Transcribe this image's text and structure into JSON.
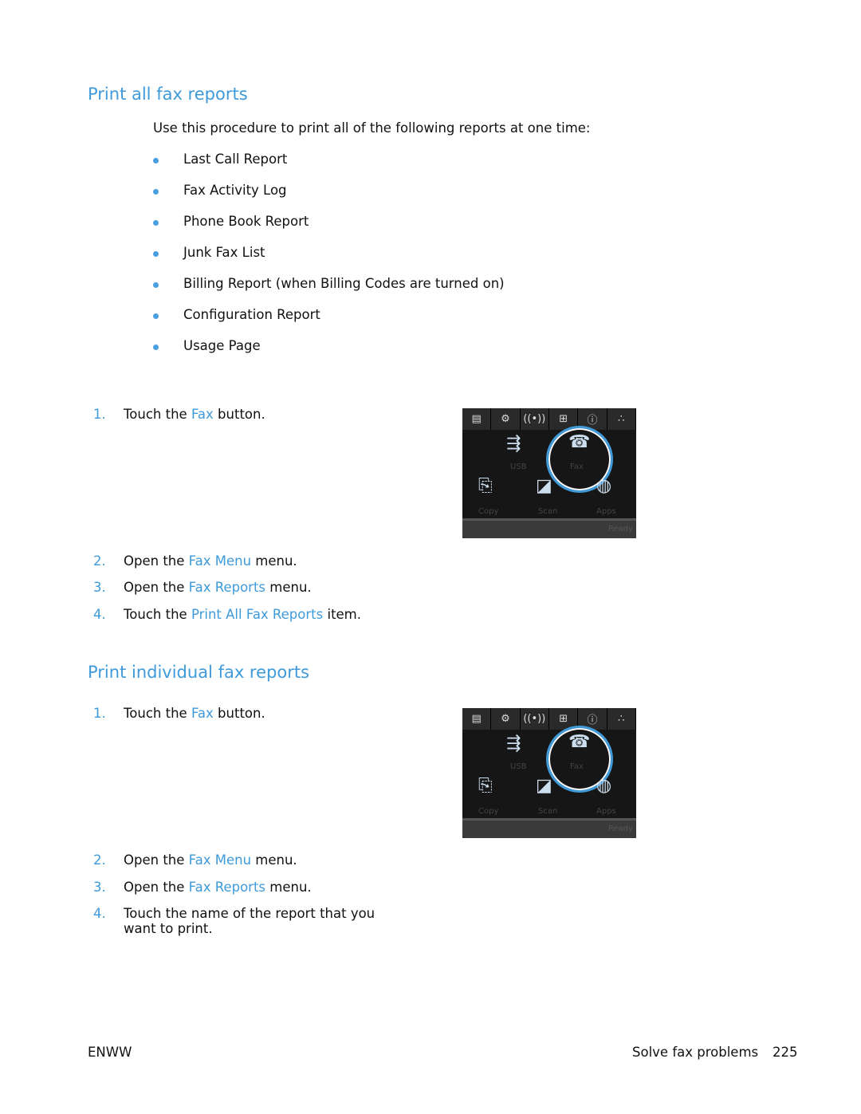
{
  "section1": {
    "title": "Print all fax reports",
    "intro": "Use this procedure to print all of the following reports at one time:",
    "bullets": [
      "Last Call Report",
      "Fax Activity Log",
      "Phone Book Report",
      "Junk Fax List",
      "Billing Report (when Billing Codes are turned on)",
      "Configuration Report",
      "Usage Page"
    ],
    "steps": [
      {
        "num": "1.",
        "pre": "Touch the ",
        "hl": "Fax",
        "post": " button."
      },
      {
        "num": "2.",
        "pre": "Open the ",
        "hl": "Fax Menu",
        "post": " menu."
      },
      {
        "num": "3.",
        "pre": "Open the ",
        "hl": "Fax Reports",
        "post": " menu."
      },
      {
        "num": "4.",
        "pre": "Touch the ",
        "hl": "Print All Fax Reports",
        "post": " item."
      }
    ]
  },
  "section2": {
    "title": "Print individual fax reports",
    "steps": [
      {
        "num": "1.",
        "pre": "Touch the ",
        "hl": "Fax",
        "post": " button."
      },
      {
        "num": "2.",
        "pre": "Open the ",
        "hl": "Fax Menu",
        "post": " menu."
      },
      {
        "num": "3.",
        "pre": "Open the ",
        "hl": "Fax Reports",
        "post": " menu."
      },
      {
        "num": "4.",
        "pre": "Touch the name of the report that you want to print.",
        "hl": "",
        "post": ""
      }
    ]
  },
  "screen": {
    "labels": [
      "USB",
      "Fax",
      "Copy",
      "Scan",
      "Apps",
      "Ready"
    ]
  },
  "footer": {
    "left": "ENWW",
    "section": "Solve fax problems",
    "page": "225"
  }
}
